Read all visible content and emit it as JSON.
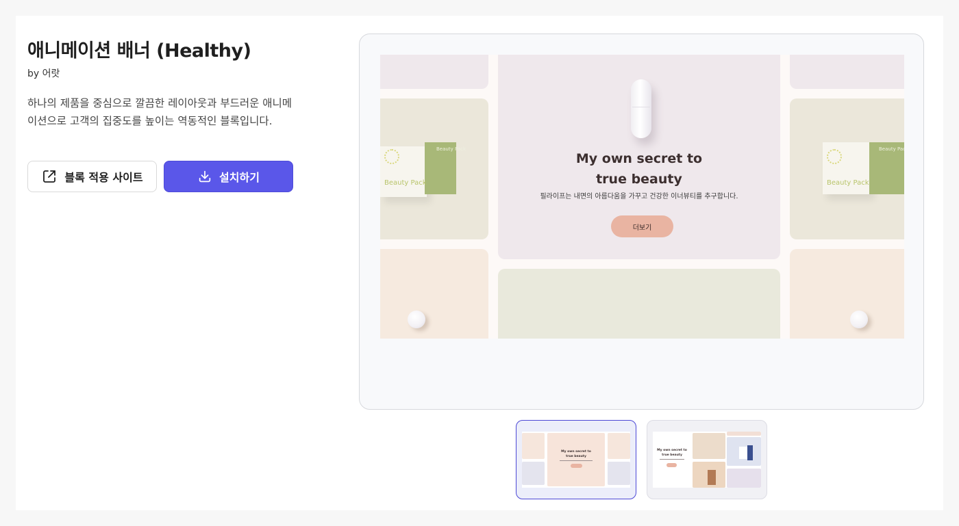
{
  "product": {
    "title": "애니메이션 배너 (Healthy)",
    "author": "by 어랏",
    "description": "하나의 제품을 중심으로 깔끔한 레이아웃과 부드러운 애니메이션으로 고객의 집중도를 높이는 역동적인 블록입니다."
  },
  "actions": {
    "sites_label": "블록 적용 사이트",
    "install_label": "설치하기",
    "sites_icon": "external-link-icon",
    "install_icon": "download-icon"
  },
  "preview": {
    "hero_title_line1": "My own secret to",
    "hero_title_line2": "true beauty",
    "hero_subtitle": "필라이프는 내면의 아름다움을 가꾸고 건강한 이너뷰티를 추구합니다.",
    "hero_button": "더보기",
    "box_label": "Beauty Pack",
    "box_label_small": "Beauty Pack"
  },
  "thumbnails": [
    {
      "name": "thumbnail-1",
      "active": true,
      "title_line1": "My own secret to",
      "title_line2": "true beauty"
    },
    {
      "name": "thumbnail-2",
      "active": false,
      "title_line1": "My own secret to",
      "title_line2": "true beauty"
    }
  ],
  "colors": {
    "primary": "#5a57e9",
    "hero_button": "#e9b4a2",
    "lavender": "#efe8ec",
    "sage": "#ebe7da",
    "peach": "#f6eadf",
    "box_green": "#a8b878"
  }
}
